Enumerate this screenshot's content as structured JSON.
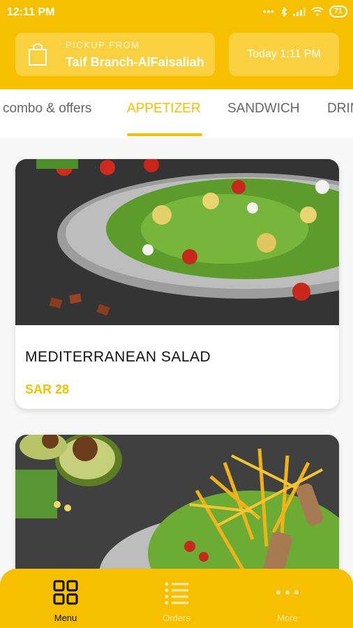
{
  "status_bar": {
    "time": "12:11 PM",
    "battery": "71"
  },
  "pickup": {
    "label": "PICKUP FROM",
    "branch": "Taif Branch-AlFaisaliah"
  },
  "time_button": {
    "label": "Today 1:11 PM"
  },
  "tabs": [
    {
      "label": "combo & offers",
      "active": false
    },
    {
      "label": "APPETIZER",
      "active": true
    },
    {
      "label": "SANDWICH",
      "active": false
    },
    {
      "label": "DRINKS",
      "active": false
    }
  ],
  "menu_items": [
    {
      "name": "MEDITERRANEAN SALAD",
      "price": "SAR 28"
    },
    {
      "name": "",
      "price": ""
    }
  ],
  "bottom_nav": [
    {
      "label": "Menu",
      "icon": "grid-icon",
      "active": true
    },
    {
      "label": "Orders",
      "icon": "list-icon",
      "active": false
    },
    {
      "label": "More",
      "icon": "more-dots-icon",
      "active": false
    }
  ],
  "colors": {
    "brand": "#f6c000",
    "background": "#f7f7f7"
  }
}
